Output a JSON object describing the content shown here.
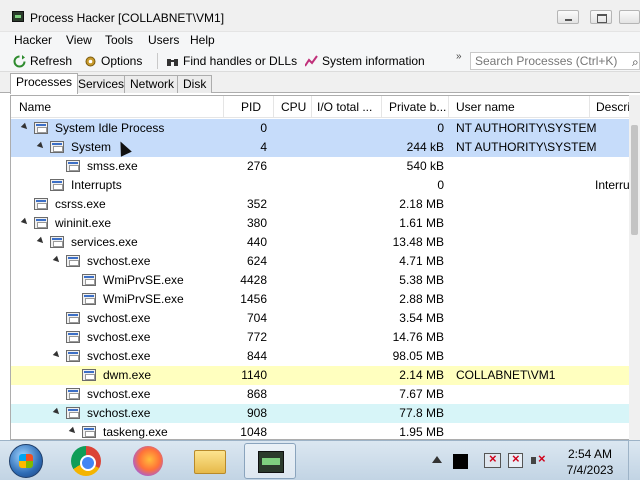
{
  "window": {
    "title": "Process Hacker [COLLABNET\\VM1]"
  },
  "menu": [
    "Hacker",
    "View",
    "Tools",
    "Users",
    "Help"
  ],
  "toolbar": {
    "refresh": "Refresh",
    "options": "Options",
    "find_handles": "Find handles or DLLs",
    "system_info": "System information",
    "search_placeholder": "Search Processes (Ctrl+K)"
  },
  "tabs": [
    "Processes",
    "Services",
    "Network",
    "Disk"
  ],
  "columns": [
    "Name",
    "PID",
    "CPU",
    "I/O total ...",
    "Private b...",
    "User name",
    "Descrip"
  ],
  "processes": [
    {
      "name": "System Idle Process",
      "pid": "0",
      "cpu": "",
      "io": "",
      "private": "0",
      "user": "NT AUTHORITY\\SYSTEM",
      "desc": ""
    },
    {
      "name": "System",
      "pid": "4",
      "cpu": "",
      "io": "",
      "private": "244 kB",
      "user": "NT AUTHORITY\\SYSTEM",
      "desc": ""
    },
    {
      "name": "smss.exe",
      "pid": "276",
      "cpu": "",
      "io": "",
      "private": "540 kB",
      "user": "",
      "desc": ""
    },
    {
      "name": "Interrupts",
      "pid": "",
      "cpu": "",
      "io": "",
      "private": "0",
      "user": "",
      "desc": "Interru"
    },
    {
      "name": "csrss.exe",
      "pid": "352",
      "cpu": "",
      "io": "",
      "private": "2.18 MB",
      "user": "",
      "desc": ""
    },
    {
      "name": "wininit.exe",
      "pid": "380",
      "cpu": "",
      "io": "",
      "private": "1.61 MB",
      "user": "",
      "desc": ""
    },
    {
      "name": "services.exe",
      "pid": "440",
      "cpu": "",
      "io": "",
      "private": "13.48 MB",
      "user": "",
      "desc": ""
    },
    {
      "name": "svchost.exe",
      "pid": "624",
      "cpu": "",
      "io": "",
      "private": "4.71 MB",
      "user": "",
      "desc": ""
    },
    {
      "name": "WmiPrvSE.exe",
      "pid": "4428",
      "cpu": "",
      "io": "",
      "private": "5.38 MB",
      "user": "",
      "desc": ""
    },
    {
      "name": "WmiPrvSE.exe",
      "pid": "1456",
      "cpu": "",
      "io": "",
      "private": "2.88 MB",
      "user": "",
      "desc": ""
    },
    {
      "name": "svchost.exe",
      "pid": "704",
      "cpu": "",
      "io": "",
      "private": "3.54 MB",
      "user": "",
      "desc": ""
    },
    {
      "name": "svchost.exe",
      "pid": "772",
      "cpu": "",
      "io": "",
      "private": "14.76 MB",
      "user": "",
      "desc": ""
    },
    {
      "name": "svchost.exe",
      "pid": "844",
      "cpu": "",
      "io": "",
      "private": "98.05 MB",
      "user": "",
      "desc": ""
    },
    {
      "name": "dwm.exe",
      "pid": "1140",
      "cpu": "",
      "io": "",
      "private": "2.14 MB",
      "user": "COLLABNET\\VM1",
      "desc": ""
    },
    {
      "name": "svchost.exe",
      "pid": "868",
      "cpu": "",
      "io": "",
      "private": "7.67 MB",
      "user": "",
      "desc": ""
    },
    {
      "name": "svchost.exe",
      "pid": "908",
      "cpu": "",
      "io": "",
      "private": "77.8 MB",
      "user": "",
      "desc": ""
    },
    {
      "name": "taskeng.exe",
      "pid": "1048",
      "cpu": "",
      "io": "",
      "private": "1.95 MB",
      "user": "",
      "desc": ""
    }
  ],
  "row_colors": {
    "system": "#c6dcfa",
    "user": "#ffffbf",
    "service": "#d7f5f8"
  },
  "clock": {
    "time": "2:54 AM",
    "date": "7/4/2023"
  }
}
